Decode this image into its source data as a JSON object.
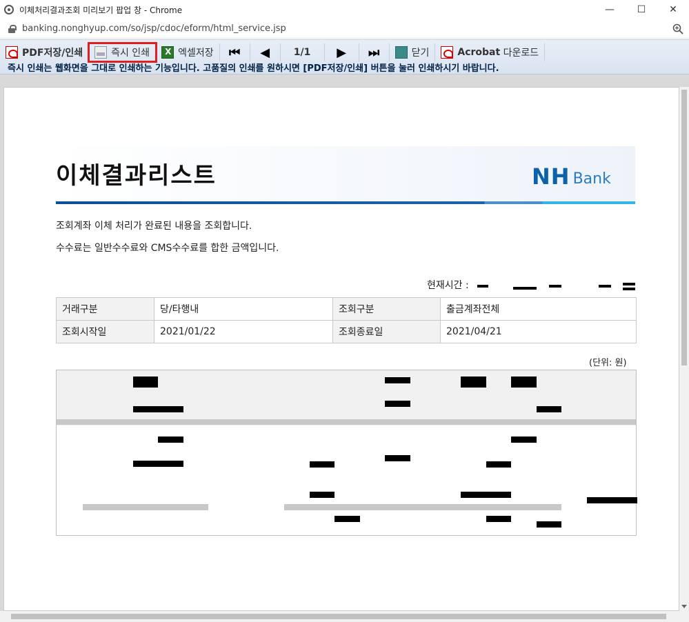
{
  "window": {
    "title": "이체처리결과조회 미리보기 팝업 창 - Chrome",
    "url": "banking.nonghyup.com/so/jsp/cdoc/eform/html_service.jsp"
  },
  "toolbar": {
    "pdf_label": "PDF저장/인쇄",
    "print_label": "즉시 인쇄",
    "excel_label": "엑셀저장",
    "page_indicator": "1/1",
    "close_label": "닫기",
    "acrobat_label_bold": "Acrobat",
    "acrobat_label_rest": " 다운로드",
    "notice": "즉시 인쇄는 웹화면을 그대로 인쇄하는 기능입니다. 고품질의 인쇄를 원하시면 [PDF저장/인쇄] 버튼을 눌러 인쇄하시기 바랍니다."
  },
  "report": {
    "title": "이체결과리스트",
    "logo_nh": "NH",
    "logo_bank": "Bank",
    "desc1": "조회계좌 이체 처리가 완료된 내용을 조회합니다.",
    "desc2": "수수료는 일반수수료와 CMS수수료를 합한 금액입니다.",
    "time_label": "현재시간 :",
    "unit": "(단위: 원)",
    "info": {
      "type_label": "거래구분",
      "type_value": "당/타행내",
      "query_label": "조회구분",
      "query_value": "출금계좌전체",
      "start_label": "조회시작일",
      "start_value": "2021/01/22",
      "end_label": "조회종료일",
      "end_value": "2021/04/21"
    }
  }
}
